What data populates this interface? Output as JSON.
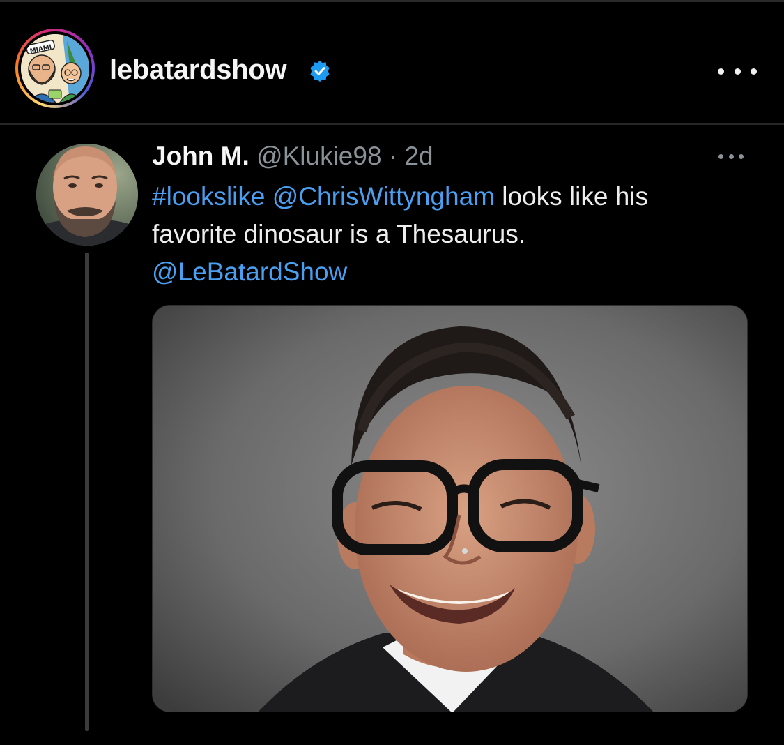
{
  "post": {
    "username": "lebatardshow",
    "verified": true,
    "avatar_logo_text": "MIAMI",
    "icons": {
      "avatar": "cartoon-hosts-avatar",
      "verified": "verified-badge-icon",
      "more": "more-horizontal-icon"
    }
  },
  "tweet": {
    "display_name": "John M.",
    "handle": "@Klukie98",
    "separator": "·",
    "time": "2d",
    "hashtag": "#lookslike",
    "mention": "@ChrisWittyngham",
    "text_part1": "looks like his",
    "text_part2": "favorite dinosaur is a Thesaurus.",
    "mention2": "@LeBatardShow",
    "image_alt": "smiling man with glasses portrait"
  },
  "colors": {
    "background": "#000000",
    "link": "#4a9ff0",
    "muted": "#8b9298",
    "verified": "#1d9bf0"
  }
}
